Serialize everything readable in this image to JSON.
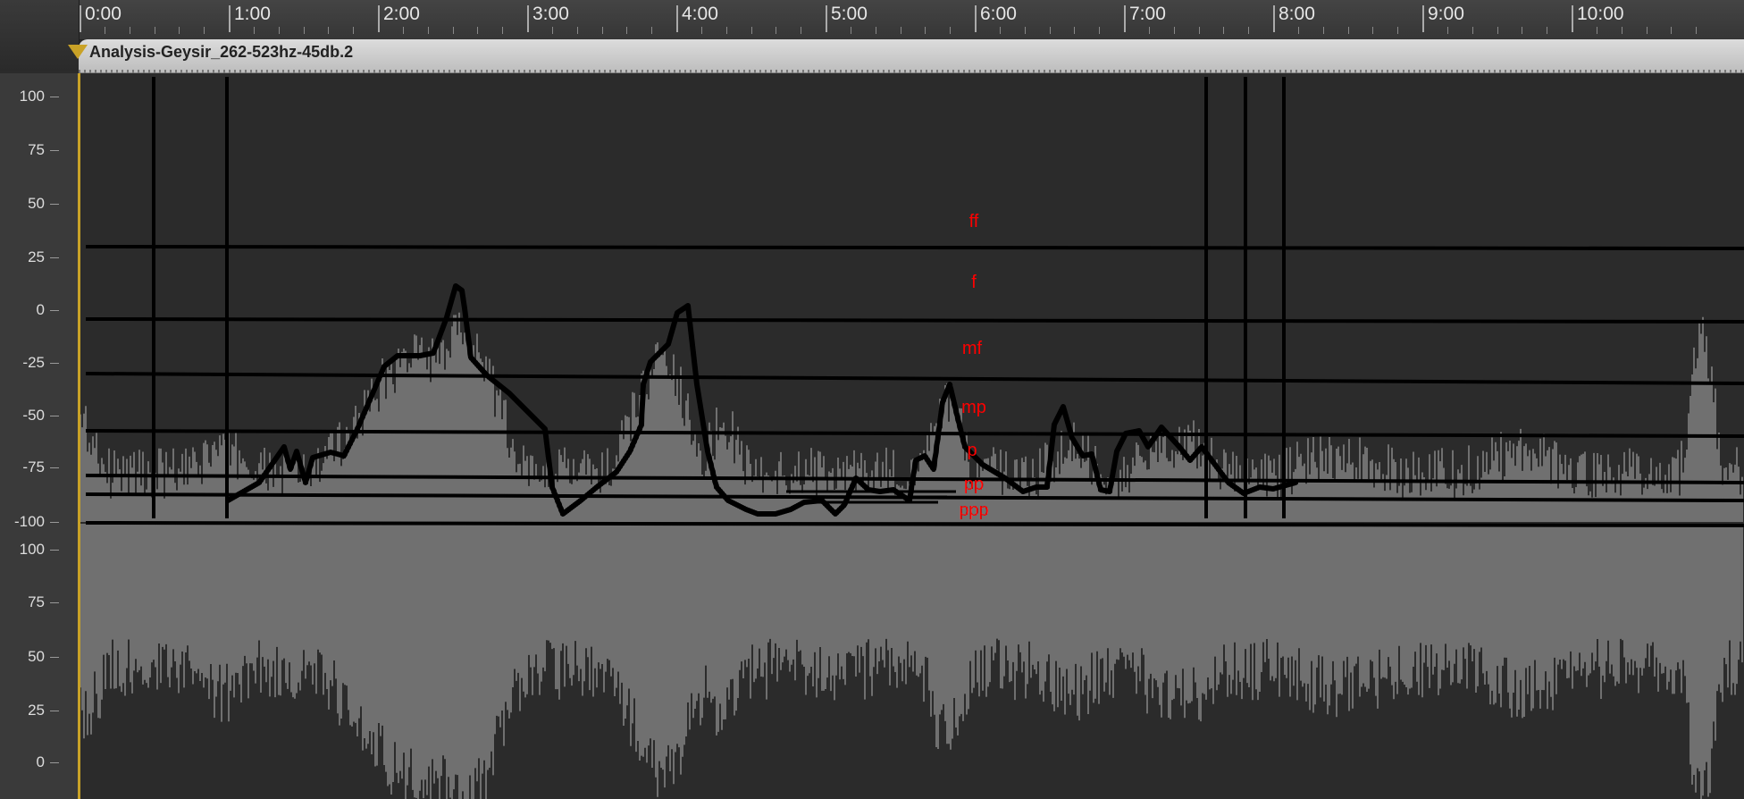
{
  "ruler": {
    "labels": [
      "0:00",
      "1:00",
      "2:00",
      "3:00",
      "4:00",
      "5:00",
      "6:00",
      "7:00",
      "8:00",
      "9:00",
      "10:00"
    ]
  },
  "clip": {
    "name": "Analysis-Geysir_262-523hz-45db.2"
  },
  "y_axis": {
    "upper": [
      "100",
      "75",
      "50",
      "25",
      "0",
      "-25",
      "-50",
      "-75",
      "-100"
    ],
    "lower": [
      "100",
      "75",
      "50",
      "25",
      "0"
    ]
  },
  "dynamics": [
    "ff",
    "f",
    "mf",
    "mp",
    "p",
    "pp",
    "ppp"
  ],
  "colors": {
    "dynamic_label": "#ff0000",
    "waveform": "#b3b3b3",
    "background": "#2b2b2b",
    "playhead": "#c9a227"
  }
}
